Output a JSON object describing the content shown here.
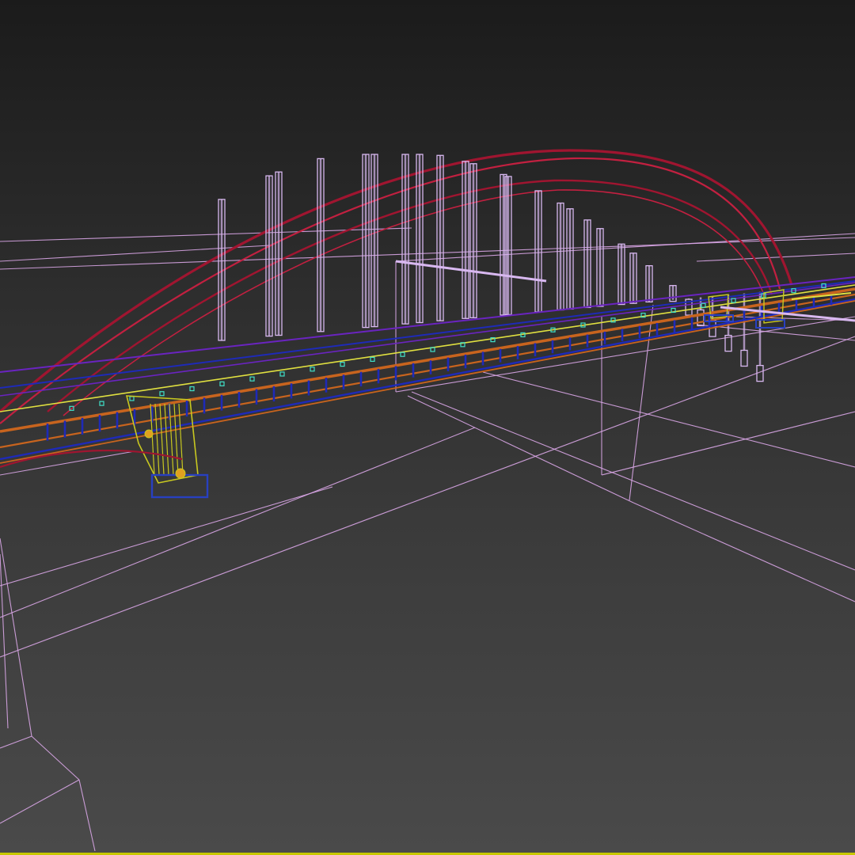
{
  "viewport": {
    "mode": "wireframe",
    "subject": "arch-bridge-model",
    "active_border_color": "#c8c800",
    "background_top": "#1b1b1b",
    "background_bottom": "#4a4a4a"
  },
  "colors": {
    "ground_wire": "#d9a6e6",
    "hanger_cables": "#d8b8f0",
    "arch_rib": "#a01530",
    "arch_rib_inner": "#c22040",
    "deck_orange": "#c8641e",
    "deck_purple": "#6a24c0",
    "deck_blue": "#1e2ab8",
    "deck_yellow": "#e0e040",
    "deck_cyan": "#40e0c8",
    "pier_yellow": "#c8c820",
    "pier_blue": "#2840c0",
    "pier_orange": "#e0a020"
  }
}
